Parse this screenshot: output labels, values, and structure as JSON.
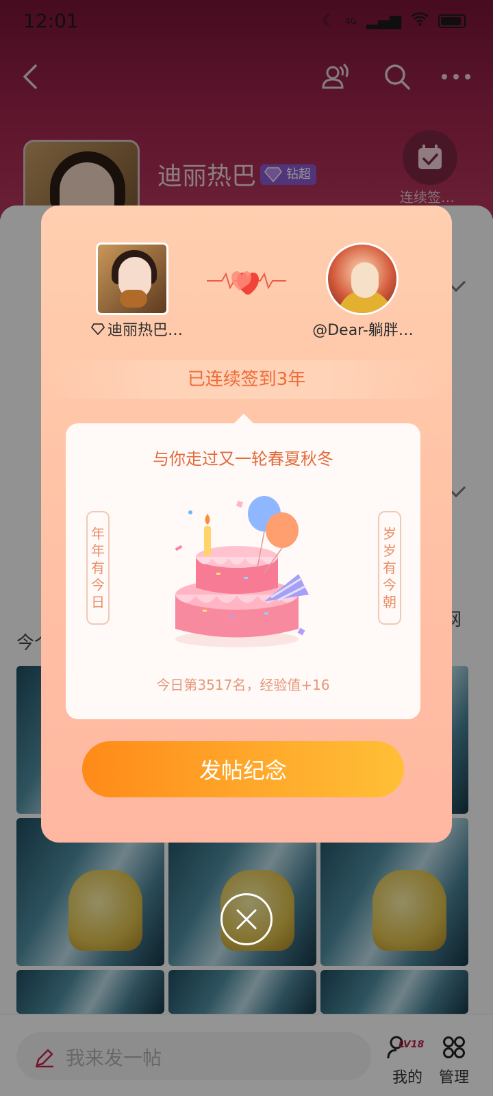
{
  "status_bar": {
    "time": "12:01",
    "network": "4G"
  },
  "bar_header": {
    "title": "迪丽热巴",
    "badge": "钻超",
    "checkin_label": "连续签…"
  },
  "feed_partial": {
    "line1": "今个",
    "line2": "网"
  },
  "bottom_bar": {
    "post_placeholder": "我来发一帖",
    "me_label": "我的",
    "level_badge": "LV18",
    "manage_label": "管理"
  },
  "modal": {
    "left_user_name": "迪丽热巴…",
    "right_user_name": "@Dear-躺胖…",
    "streak_text": "已连续签到3年",
    "card_title": "与你走过又一轮春夏秋冬",
    "couplet_left": [
      "年",
      "年",
      "有",
      "今",
      "日"
    ],
    "couplet_right": [
      "岁",
      "岁",
      "有",
      "今",
      "朝"
    ],
    "rank_text": "今日第3517名，经验值+16",
    "post_button": "发帖纪念"
  },
  "colors": {
    "header_bg": "#a3274f",
    "accent_orange": "#ff8a18",
    "streak_text": "#ee6c3a",
    "badge_purple": "#8e5ad2"
  },
  "icons": [
    "back-icon",
    "people-icon",
    "search-icon",
    "more-icon",
    "calendar-check-icon",
    "diamond-icon",
    "heart-pulse-icon",
    "pencil-icon",
    "me-icon",
    "manage-icon",
    "close-icon"
  ]
}
